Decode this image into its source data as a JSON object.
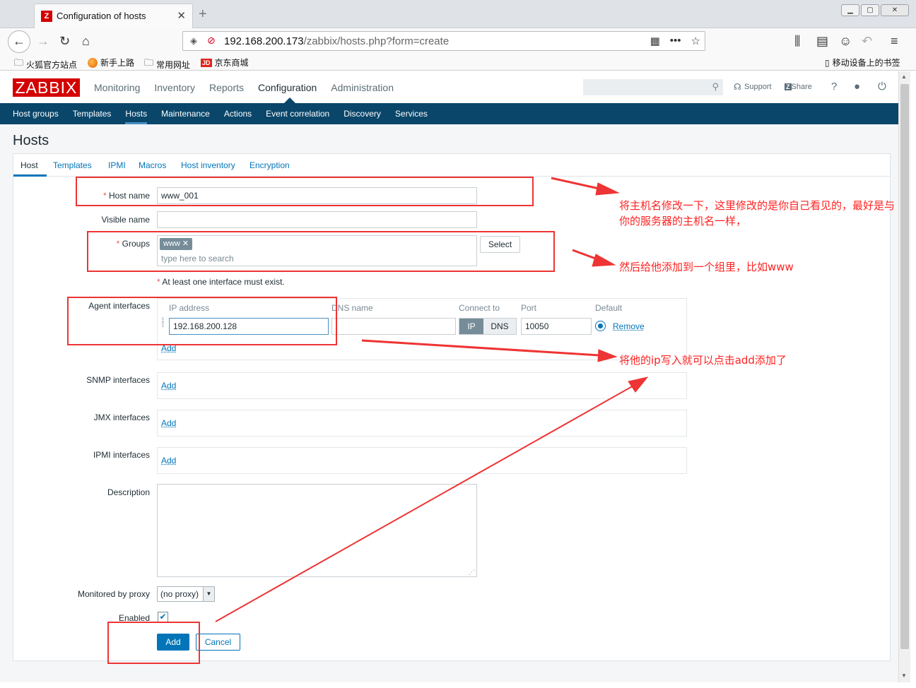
{
  "browser": {
    "tab_title": "Configuration of hosts",
    "tab_close": "✕",
    "new_tab": "+",
    "url_host": "192.168.200.173",
    "url_path": "/zabbix/hosts.php?form=create",
    "bookmarks": [
      "火狐官方站点",
      "新手上路",
      "常用网址",
      "京东商城"
    ],
    "mobile_bookmarks": "移动设备上的书签"
  },
  "zabbix": {
    "logo": "ZABBIX",
    "top_menu": [
      "Monitoring",
      "Inventory",
      "Reports",
      "Configuration",
      "Administration"
    ],
    "support": "Support",
    "share": "Share",
    "help": "?",
    "sub_menu": [
      "Host groups",
      "Templates",
      "Hosts",
      "Maintenance",
      "Actions",
      "Event correlation",
      "Discovery",
      "Services"
    ]
  },
  "page": {
    "title": "Hosts",
    "tabs": [
      "Host",
      "Templates",
      "IPMI",
      "Macros",
      "Host inventory",
      "Encryption"
    ]
  },
  "form": {
    "host_name_label": "Host name",
    "host_name_value": "www_001",
    "visible_name_label": "Visible name",
    "visible_name_value": "",
    "groups_label": "Groups",
    "group_tag": "www",
    "groups_placeholder": "type here to search",
    "select_button": "Select",
    "interface_note": "At least one interface must exist.",
    "required_mark": "*",
    "agent_label": "Agent interfaces",
    "col_ip": "IP address",
    "col_dns": "DNS name",
    "col_connect": "Connect to",
    "col_port": "Port",
    "col_default": "Default",
    "ip_value": "192.168.200.128",
    "dns_value": "",
    "connect_ip": "IP",
    "connect_dns": "DNS",
    "port_value": "10050",
    "remove": "Remove",
    "add": "Add",
    "snmp_label": "SNMP interfaces",
    "jmx_label": "JMX interfaces",
    "ipmi_label": "IPMI interfaces",
    "description_label": "Description",
    "proxy_label": "Monitored by proxy",
    "proxy_value": "(no proxy)",
    "enabled_label": "Enabled",
    "enabled_checked": true,
    "add_button": "Add",
    "cancel_button": "Cancel"
  },
  "annotations": {
    "note1": "将主机名修改一下，这里修改的是你自己看见的，最好是与你的服务器的主机名一样，",
    "note2": "然后给他添加到一个组里，比如www",
    "note3": "将他的ip写入就可以点击add添加了",
    "color": "#ff2121"
  }
}
